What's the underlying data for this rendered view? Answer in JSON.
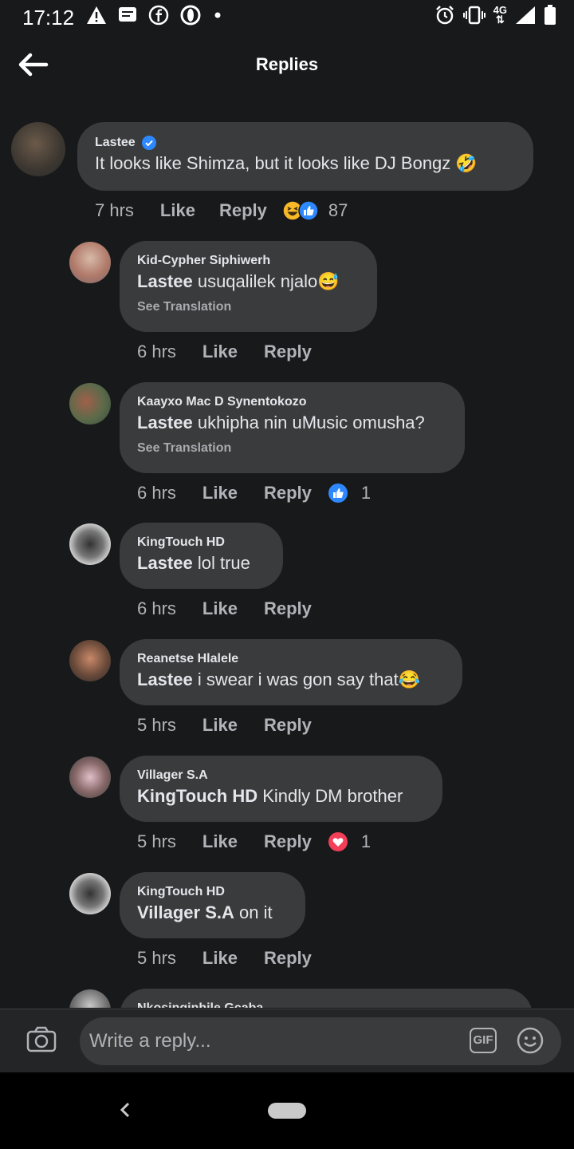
{
  "status_bar": {
    "time": "17:12",
    "network": "4G",
    "left_icons": [
      "warning-icon",
      "message-icon",
      "facebook-icon",
      "opera-icon",
      "dot-icon"
    ],
    "right_icons": [
      "alarm-icon",
      "vibrate-icon",
      "network-4g-icon",
      "signal-icon",
      "battery-icon"
    ]
  },
  "header": {
    "title": "Replies",
    "back_icon": "back-arrow-icon"
  },
  "comments": [
    {
      "author": "Lastee",
      "verified": true,
      "text": "It looks like Shimza, but it looks like DJ Bongz 🤣",
      "time": "7 hrs",
      "like": "Like",
      "reply": "Reply",
      "reactions": [
        "haha",
        "like"
      ],
      "reaction_count": "87"
    },
    {
      "author": "Kid-Cypher Siphiwerh",
      "mention": "Lastee",
      "text": " usuqalilek njalo😅",
      "translation": "See Translation",
      "time": "6 hrs",
      "like": "Like",
      "reply": "Reply"
    },
    {
      "author": "Kaayxo Mac D Synentokozo",
      "mention": "Lastee",
      "text": " ukhipha nin uMusic omusha?",
      "translation": "See Translation",
      "time": "6 hrs",
      "like": "Like",
      "reply": "Reply",
      "reactions": [
        "like"
      ],
      "reaction_count": "1"
    },
    {
      "author": "KingTouch HD",
      "mention": "Lastee",
      "text": " lol true",
      "time": "6 hrs",
      "like": "Like",
      "reply": "Reply"
    },
    {
      "author": "Reanetse Hlalele",
      "mention": "Lastee",
      "text": " i swear i was gon say that😂",
      "time": "5 hrs",
      "like": "Like",
      "reply": "Reply"
    },
    {
      "author": "Villager S.A",
      "mention": "KingTouch HD",
      "text": " Kindly DM brother",
      "time": "5 hrs",
      "like": "Like",
      "reply": "Reply",
      "reactions": [
        "love"
      ],
      "reaction_count": "1"
    },
    {
      "author": "KingTouch HD",
      "mention": "Villager S.A",
      "text": " on it",
      "time": "5 hrs",
      "like": "Like",
      "reply": "Reply"
    },
    {
      "author": "Nkosinginhile Gcaba"
    }
  ],
  "reply_bar": {
    "placeholder": "Write a reply...",
    "gif_label": "GIF",
    "camera_icon": "camera-icon",
    "emoji_icon": "emoji-icon"
  },
  "nav_bar": {
    "back_icon": "nav-back-icon",
    "home_icon": "home-pill-icon"
  },
  "colors": {
    "background": "#18191a",
    "bubble": "#3a3b3c",
    "text": "#e4e6eb",
    "secondary_text": "#b0b3b8",
    "verified": "#2d88ff",
    "like_blue": "#2d88ff",
    "love_red": "#f33e58"
  }
}
